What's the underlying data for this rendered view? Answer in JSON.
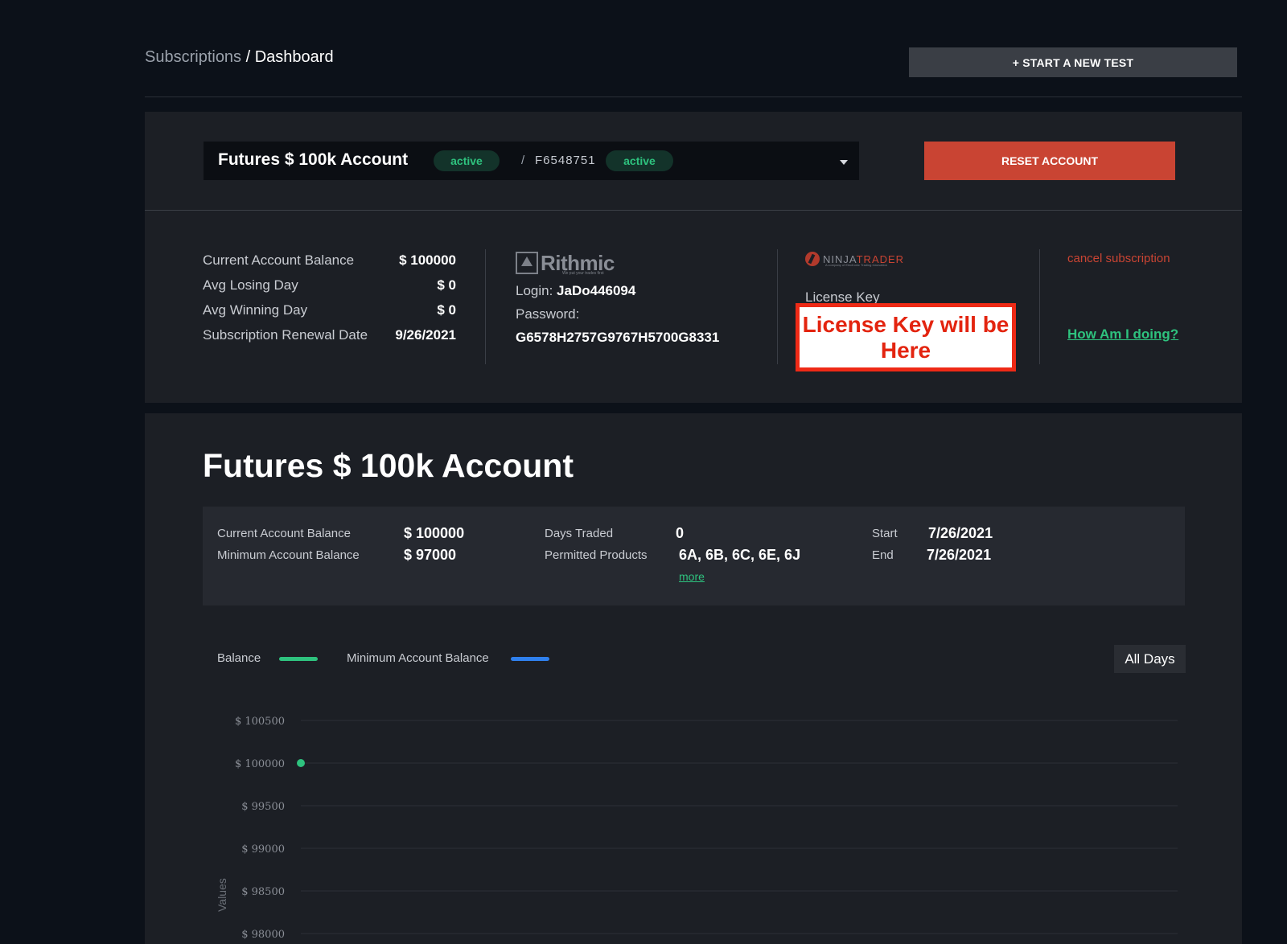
{
  "header": {
    "breadcrumb_parent": "Subscriptions",
    "breadcrumb_sep": " / ",
    "breadcrumb_current": "Dashboard",
    "start_button": "+ START A NEW TEST"
  },
  "account_selector": {
    "title": "Futures $ 100k Account",
    "status": "active",
    "separator": "/",
    "account_id": "F6548751",
    "id_status": "active",
    "reset_button": "RESET ACCOUNT"
  },
  "summary": {
    "rows": [
      {
        "label": "Current Account Balance",
        "value": "$ 100000"
      },
      {
        "label": "Avg Losing Day",
        "value": "$ 0"
      },
      {
        "label": "Avg Winning Day",
        "value": "$ 0"
      },
      {
        "label": "Subscription Renewal Date",
        "value": "9/26/2021"
      }
    ]
  },
  "rithmic": {
    "logo_text": "Rithmic",
    "logo_tagline": "We put your trades first",
    "login_label": "Login: ",
    "login_value": "JaDo446094",
    "password_label": "Password:",
    "password_value": "G6578H2757G9767H5700G8331"
  },
  "ninjatrader": {
    "logo_part1": "NINJA",
    "logo_part2": "TRADER",
    "logo_tagline": "A company of Electronic Trading Innovation",
    "license_label": "License Key",
    "license_placeholder": "License Key will be  Here"
  },
  "links": {
    "cancel": "cancel subscription",
    "how": "How Am I doing?"
  },
  "details": {
    "title": "Futures $ 100k Account",
    "current_balance_label": "Current Account Balance",
    "current_balance_value": "$ 100000",
    "min_balance_label": "Minimum Account Balance",
    "min_balance_value": "$ 97000",
    "days_traded_label": "Days Traded",
    "days_traded_value": "0",
    "permitted_label": "Permitted Products",
    "permitted_value": "6A, 6B, 6C, 6E, 6J",
    "more_link": "more",
    "start_label": "Start",
    "start_value": "7/26/2021",
    "end_label": "End",
    "end_value": "7/26/2021"
  },
  "chart_legend": {
    "balance": "Balance",
    "min_balance": "Minimum Account Balance",
    "range_button": "All Days"
  },
  "colors": {
    "accent_green": "#2ec27e",
    "accent_blue": "#2f80ed",
    "danger_red": "#c94433",
    "license_red": "#ee2a16"
  },
  "chart_data": {
    "type": "line",
    "ylabel": "Values",
    "yticks": [
      "$ 100500",
      "$ 100000",
      "$ 99500",
      "$ 99000",
      "$ 98500",
      "$ 98000"
    ],
    "ytick_values": [
      100500,
      100000,
      99500,
      99000,
      98500,
      98000
    ],
    "ylim": [
      98000,
      100500
    ],
    "series": [
      {
        "name": "Balance",
        "color": "#2ec27e",
        "values": [
          100000
        ]
      },
      {
        "name": "Minimum Account Balance",
        "color": "#2f80ed",
        "values": [
          97000
        ]
      }
    ],
    "grid": true
  }
}
